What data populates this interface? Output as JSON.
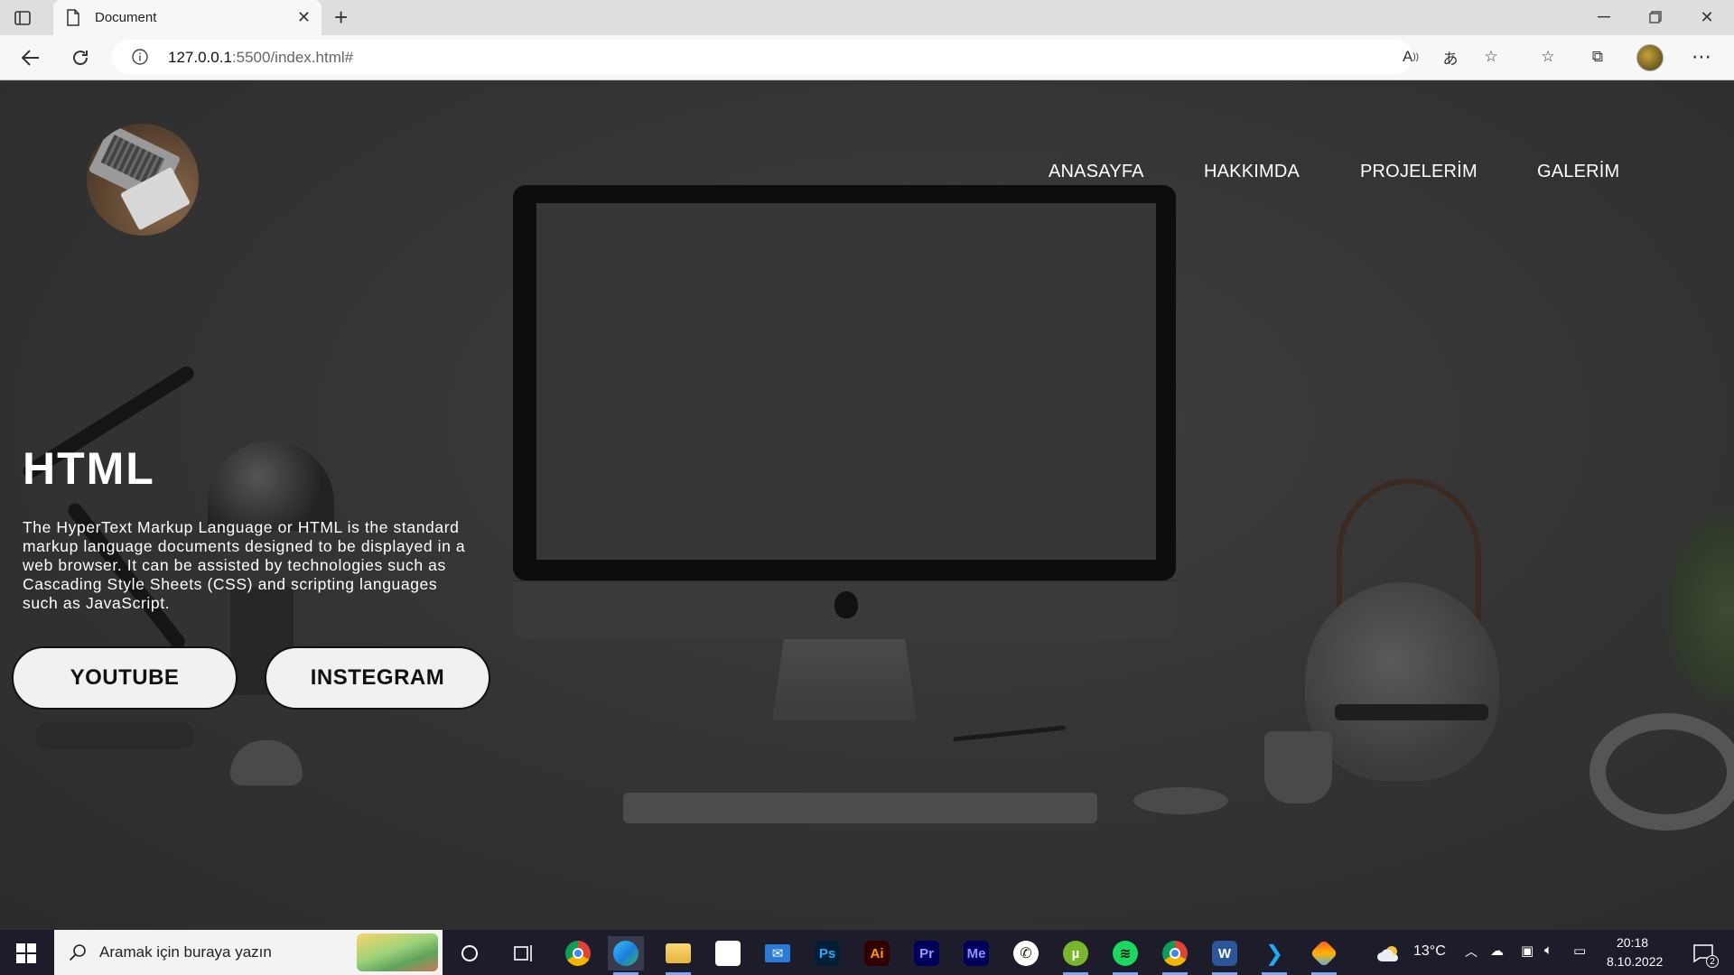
{
  "browser": {
    "tab_title": "Document",
    "url_host": "127.0.0.1",
    "url_path": ":5500/index.html#"
  },
  "nav": {
    "items": [
      {
        "label": "ANASAYFA"
      },
      {
        "label": "HAKKIMDA"
      },
      {
        "label": "PROJELERİM"
      },
      {
        "label": "GALERİM"
      }
    ]
  },
  "hero": {
    "title": "HTML",
    "description": "The HyperText Markup Language or HTML is the standard markup language documents designed to be displayed in a web browser. It can be assisted by technologies such as Cascading Style Sheets (CSS) and scripting languages such as JavaScript.",
    "buttons": {
      "youtube": "YOUTUBE",
      "instagram": "INSTEGRAM"
    }
  },
  "taskbar": {
    "search_placeholder": "Aramak için buraya yazın",
    "apps": [
      {
        "name": "cortana-icon"
      },
      {
        "name": "task-view-icon"
      },
      {
        "name": "chrome-icon"
      },
      {
        "name": "edge-icon"
      },
      {
        "name": "file-explorer-icon"
      },
      {
        "name": "store-icon"
      },
      {
        "name": "mail-icon"
      },
      {
        "name": "photoshop-icon",
        "label": "Ps"
      },
      {
        "name": "illustrator-icon",
        "label": "Ai"
      },
      {
        "name": "premiere-icon",
        "label": "Pr"
      },
      {
        "name": "media-encoder-icon",
        "label": "Me"
      },
      {
        "name": "whatsapp-icon"
      },
      {
        "name": "utorrent-icon"
      },
      {
        "name": "spotify-icon"
      },
      {
        "name": "chrome-profile-icon"
      },
      {
        "name": "word-icon"
      },
      {
        "name": "vscode-icon"
      },
      {
        "name": "git-icon"
      }
    ],
    "weather": "13°C",
    "time": "20:18",
    "date": "8.10.2022",
    "notification_count": "2"
  },
  "colors": {
    "page_overlay": "#333333",
    "button_bg": "#f1f1f1",
    "text_light": "#ffffff",
    "taskbar_bg": "#1c1c2a"
  }
}
